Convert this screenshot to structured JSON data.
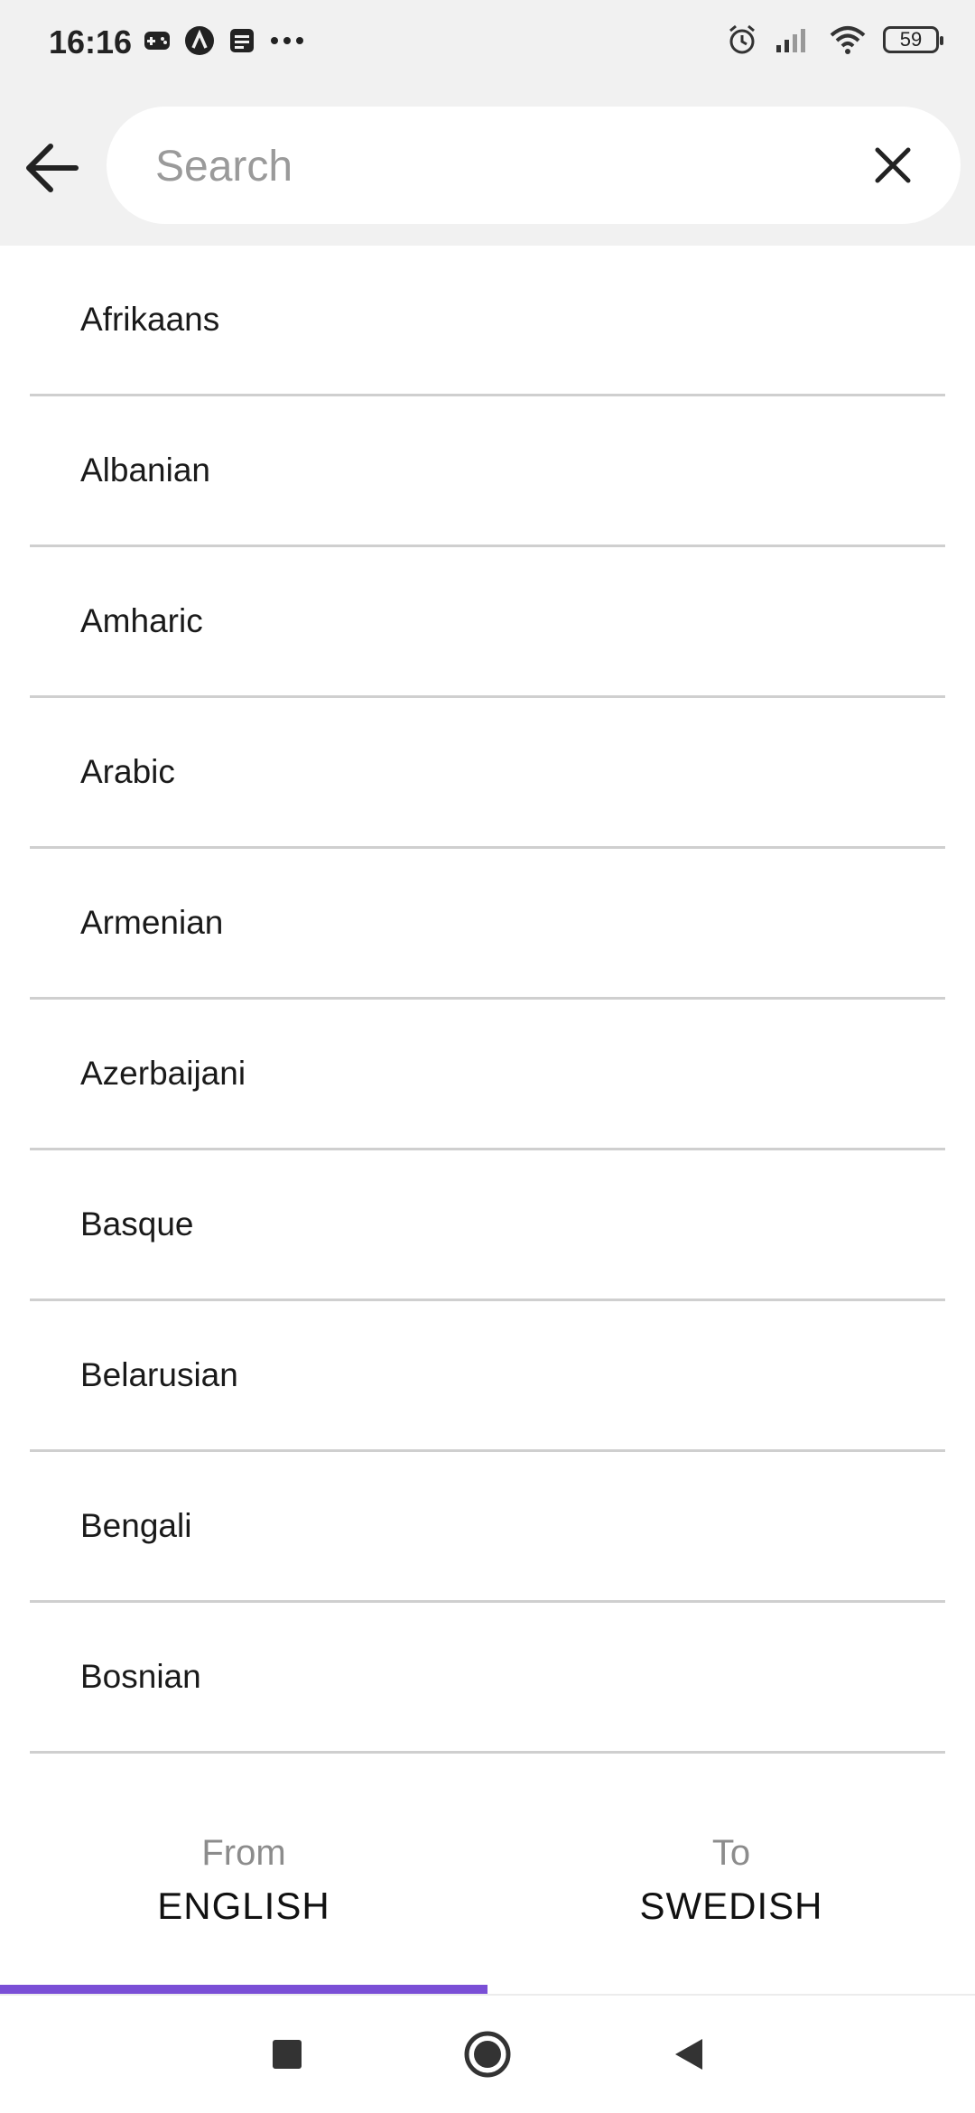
{
  "status": {
    "time": "16:16",
    "battery": "59"
  },
  "search": {
    "placeholder": "Search",
    "value": ""
  },
  "languages": [
    "Afrikaans",
    "Albanian",
    "Amharic",
    "Arabic",
    "Armenian",
    "Azerbaijani",
    "Basque",
    "Belarusian",
    "Bengali",
    "Bosnian"
  ],
  "tabs": {
    "from": {
      "label": "From",
      "value": "ENGLISH",
      "selected": true
    },
    "to": {
      "label": "To",
      "value": "SWEDISH",
      "selected": false
    }
  },
  "colors": {
    "accent": "#7a4fd6",
    "header_bg": "#f1f1f1",
    "divider": "#cfcfcf"
  }
}
